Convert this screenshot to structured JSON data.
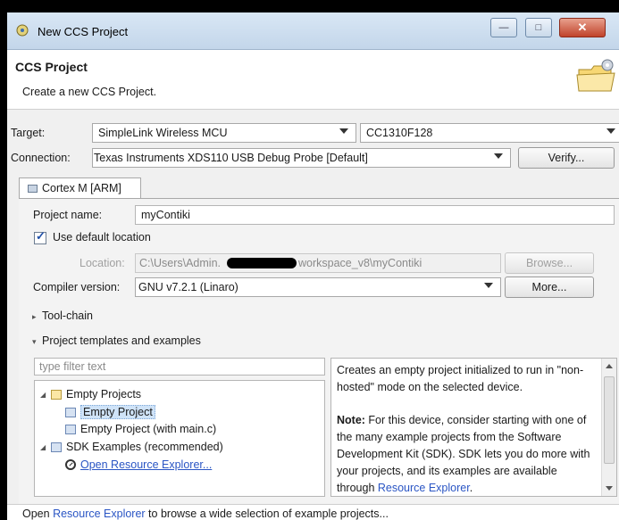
{
  "window": {
    "title": "New CCS Project",
    "title_icon": "ccs-icon"
  },
  "header": {
    "title": "CCS Project",
    "subtitle": "Create a new CCS Project.",
    "icon": "wizard-folder-icon"
  },
  "target": {
    "label": "Target:",
    "family": "SimpleLink Wireless MCU",
    "device": "CC1310F128"
  },
  "connection": {
    "label": "Connection:",
    "value": "Texas Instruments XDS110 USB Debug Probe [Default]",
    "verify_label": "Verify..."
  },
  "tab": {
    "label": "Cortex M [ARM]"
  },
  "project": {
    "name_label": "Project name:",
    "name_value": "myContiki",
    "use_default_label": "Use default location",
    "use_default_checked": true,
    "location_label": "Location:",
    "location_prefix": "C:\\Users\\Admin.",
    "location_suffix": "workspace_v8\\myContiki",
    "browse_label": "Browse...",
    "compiler_label": "Compiler version:",
    "compiler_value": "GNU v7.2.1 (Linaro)",
    "more_label": "More..."
  },
  "sections": {
    "toolchain": "Tool-chain",
    "templates": "Project templates and examples"
  },
  "templates": {
    "filter_placeholder": "type filter text",
    "tree": {
      "empty_projects": "Empty Projects",
      "empty_project": "Empty Project",
      "empty_project_main": "Empty Project (with main.c)",
      "sdk_examples": "SDK Examples (recommended)",
      "open_resource_explorer": "Open Resource Explorer..."
    },
    "description": {
      "p1": "Creates an empty project initialized to run in \"non-hosted\" mode on the selected device.",
      "note_label": "Note:",
      "p2_text": " For this device, consider starting with one of the many example projects from the Software Development Kit (SDK). SDK lets you do more with your projects, and its examples are available through ",
      "p2_link": "Resource Explorer",
      "p2_end": "."
    }
  },
  "footer": {
    "prefix": "Open ",
    "link": "Resource Explorer",
    "suffix": " to browse a wide selection of example projects..."
  }
}
